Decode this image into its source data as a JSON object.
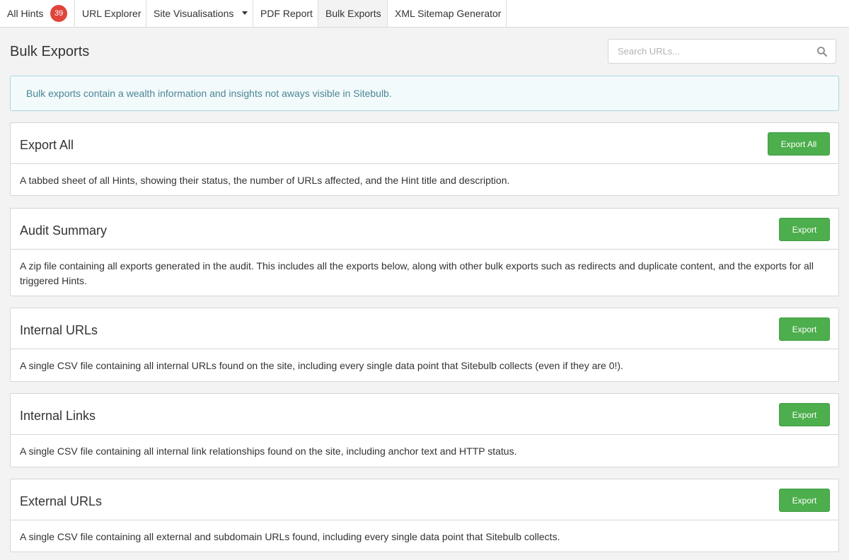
{
  "nav": {
    "tabs": [
      {
        "label": "All Hints",
        "badge": "39"
      },
      {
        "label": "URL Explorer"
      },
      {
        "label": "Site Visualisations"
      },
      {
        "label": "PDF Report"
      },
      {
        "label": "Bulk Exports"
      },
      {
        "label": "XML Sitemap Generator"
      }
    ],
    "active": "Bulk Exports"
  },
  "page": {
    "title": "Bulk Exports",
    "search_placeholder": "Search URLs..."
  },
  "alert": {
    "text": "Bulk exports contain a wealth information and insights not aways visible in Sitebulb."
  },
  "cards": [
    {
      "title": "Export All",
      "button": "Export All",
      "description": "A tabbed sheet of all Hints, showing their status, the number of URLs affected, and the Hint title and description."
    },
    {
      "title": "Audit Summary",
      "button": "Export",
      "description": "A zip file containing all exports generated in the audit. This includes all the exports below, along with other bulk exports such as redirects and duplicate content, and the exports for all triggered Hints."
    },
    {
      "title": "Internal URLs",
      "button": "Export",
      "description": "A single CSV file containing all internal URLs found on the site, including every single data point that Sitebulb collects (even if they are 0!)."
    },
    {
      "title": "Internal Links",
      "button": "Export",
      "description": "A single CSV file containing all internal link relationships found on the site, including anchor text and HTTP status."
    },
    {
      "title": "External URLs",
      "button": "Export",
      "description": "A single CSV file containing all external and subdomain URLs found, including every single data point that Sitebulb collects."
    }
  ],
  "colors": {
    "badge": "#e0443a",
    "button": "#4cae4c",
    "alert_text": "#4a8696",
    "alert_border": "#a8d7e2"
  }
}
